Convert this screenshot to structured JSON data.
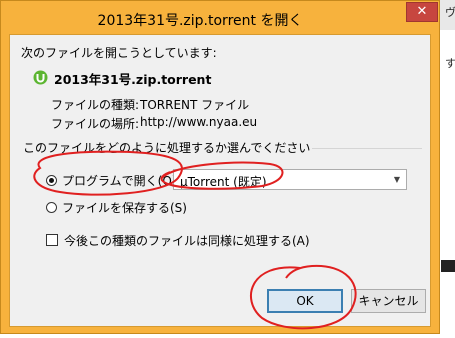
{
  "window": {
    "title": "2013年31号.zip.torrent を開く",
    "close_glyph": "✕"
  },
  "intro_text": "次のファイルを開こうとしています:",
  "file": {
    "name": "2013年31号.zip.torrent",
    "type_label": "ファイルの種類:",
    "type_value": "TORRENT ファイル",
    "location_label": "ファイルの場所:",
    "location_value": "http://www.nyaa.eu"
  },
  "action_group_label": "このファイルをどのように処理するか選んでください",
  "options": {
    "open_with_label": "プログラムで開く(O):",
    "open_with_selected": true,
    "program_value": "µTorrent (既定)",
    "save_label": "ファイルを保存する(S)",
    "save_selected": false,
    "remember_label": "今後この種類のファイルは同様に処理する(A)",
    "remember_checked": false
  },
  "buttons": {
    "ok_label": "OK",
    "cancel_label": "キャンセル"
  },
  "background_chars": [
    "ヴ",
    "す"
  ],
  "colors": {
    "frame": "#f7b23d",
    "close": "#c7463f",
    "annotation": "#e02020",
    "ok_border": "#3c7fb1",
    "utorrent": "#5cb531"
  }
}
